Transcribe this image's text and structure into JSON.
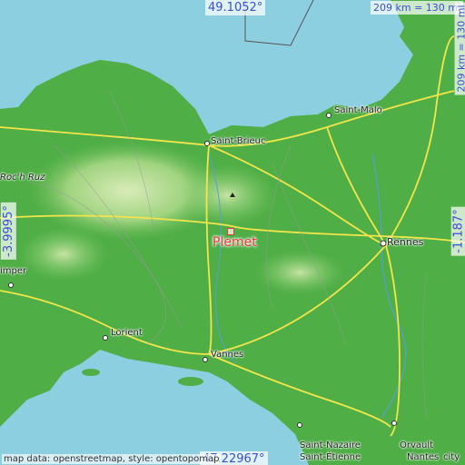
{
  "place": {
    "name": "Plemet",
    "marker_color": "#e83a3a"
  },
  "coordinates": {
    "top": "49.1052°",
    "bottom": "47.22967°",
    "left": "-3.9995°",
    "right": "-1.187°"
  },
  "scale": {
    "horizontal": "209 km = 130 mi",
    "vertical": "209 km = 130 mi"
  },
  "attribution": "map data: openstreetmap, style: opentopomap",
  "cities": [
    {
      "key": "saint_malo",
      "label": "Saint-Malo"
    },
    {
      "key": "saint_brieuc",
      "label": "Saint-Brieuc"
    },
    {
      "key": "roch_ruz",
      "label": "Roc'h Ruz"
    },
    {
      "key": "rennes",
      "label": "Rennes"
    },
    {
      "key": "quimper",
      "label": "imper"
    },
    {
      "key": "lorient",
      "label": "Lorient"
    },
    {
      "key": "vannes",
      "label": "Vannes"
    },
    {
      "key": "saint_nazaire",
      "label": "Saint-Nazaire"
    },
    {
      "key": "orvault",
      "label": "Orvault"
    },
    {
      "key": "nantes",
      "label": "Nantes"
    },
    {
      "key": "saint_etienne",
      "label": "Saint-Étienne"
    },
    {
      "key": "city",
      "label": "city"
    }
  ],
  "colors": {
    "sea": "#8ccfe0",
    "lowland": "#3da63a",
    "highland": "#a7d68a",
    "road": "#f2e64b",
    "coord_text": "#3a4fd1"
  }
}
